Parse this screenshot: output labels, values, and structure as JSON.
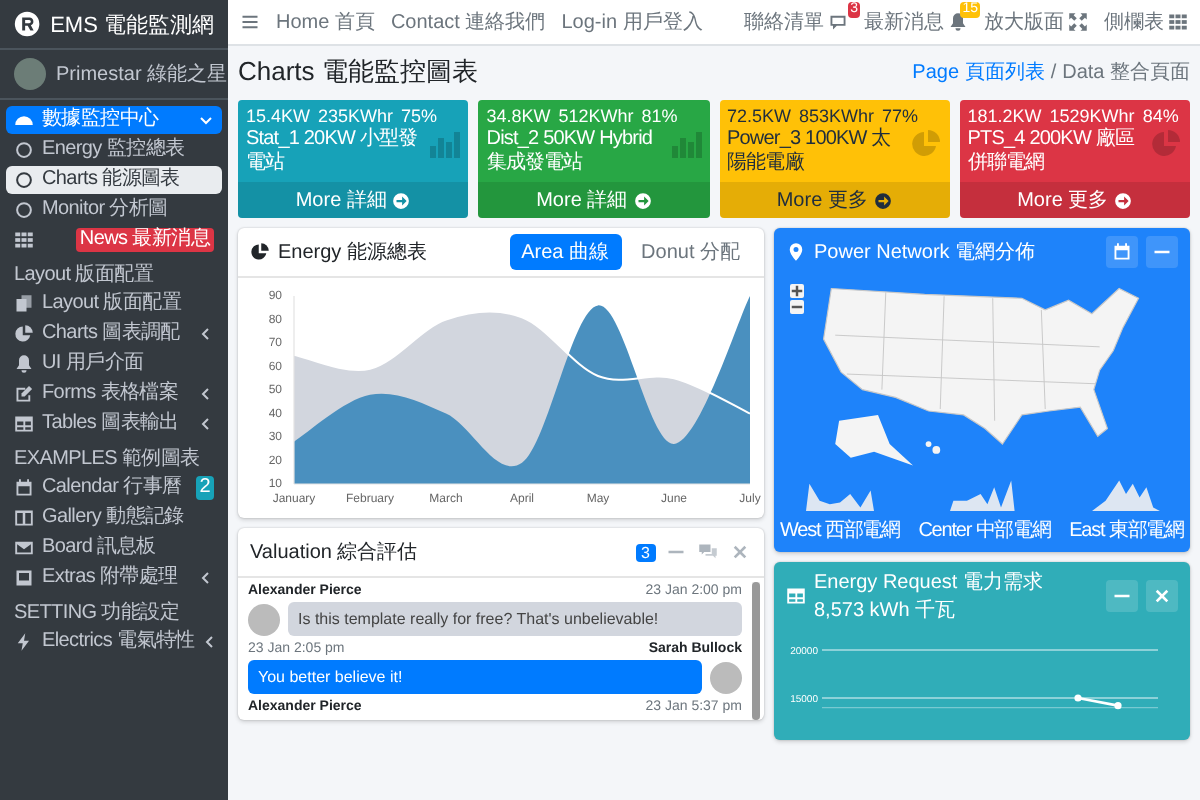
{
  "brand": {
    "title": "EMS 電能監測網"
  },
  "user": {
    "name": "Primestar 綠能之星"
  },
  "sidebar": {
    "items": [
      {
        "kind": "link",
        "label": "數據監控中心",
        "selected": true,
        "expanded": true,
        "children": [
          {
            "label": "Energy 監控總表",
            "selected": false
          },
          {
            "label": "Charts 能源圖表",
            "selected": true
          },
          {
            "label": "Monitor 分析圖",
            "selected": false
          }
        ]
      },
      {
        "kind": "link",
        "selected": false,
        "badge": {
          "text": "News 最新消息",
          "color": "#dc3545"
        }
      },
      {
        "kind": "header",
        "label": "Layout 版面配置"
      },
      {
        "kind": "link",
        "label": "Layout 版面配置",
        "selected": false
      },
      {
        "kind": "link",
        "label": "Charts 圖表調配",
        "selected": false,
        "expanded": false
      },
      {
        "kind": "link",
        "label": "UI 用戶介面",
        "selected": false
      },
      {
        "kind": "link",
        "label": "Forms 表格檔案",
        "selected": false,
        "expanded": false
      },
      {
        "kind": "link",
        "label": "Tables 圖表輸出",
        "selected": false,
        "expanded": false
      },
      {
        "kind": "header",
        "label": "EXAMPLES 範例圖表"
      },
      {
        "kind": "link",
        "label": "Calendar 行事曆",
        "selected": false,
        "badge": {
          "text": "2",
          "color": "#17a2b8"
        }
      },
      {
        "kind": "link",
        "label": "Gallery 動態記錄",
        "selected": false
      },
      {
        "kind": "link",
        "label": "Board 訊息板",
        "selected": false
      },
      {
        "kind": "link",
        "label": "Extras 附帶處理",
        "selected": false,
        "expanded": false
      },
      {
        "kind": "header",
        "label": "SETTING 功能設定"
      },
      {
        "kind": "link",
        "label": "Electrics 電氣特性",
        "selected": false,
        "expanded": false
      }
    ]
  },
  "navbar": {
    "links": [
      "Home 首頁",
      "Contact 連絡我們",
      "Log-in 用戶登入"
    ],
    "actions": [
      {
        "label": "聯絡清單",
        "badge": {
          "text": "3",
          "color": "#dc3545"
        }
      },
      {
        "label": "最新消息",
        "badge": {
          "text": "15",
          "color": "#ffc107"
        }
      },
      {
        "label": "放大版面"
      },
      {
        "label": "側欄表"
      }
    ]
  },
  "page": {
    "title": "Charts 電能監控圖表",
    "breadcrumb": [
      {
        "label": "Page 頁面列表",
        "selected": false
      },
      {
        "label": "Data 整合頁面",
        "selected": true
      }
    ],
    "separator": "/"
  },
  "boxes": [
    {
      "stats": [
        "15.4KW",
        "235KWhr",
        "75%"
      ],
      "subtitle": "Stat_1 20KW 小型發電站",
      "link": "More 詳細",
      "color": "#17a2b8"
    },
    {
      "stats": [
        "34.8KW",
        "512KWhr",
        "81%"
      ],
      "subtitle": "Dist_2 50KW Hybrid 集成發電站",
      "link": "More 詳細",
      "color": "#28a745"
    },
    {
      "stats": [
        "72.5KW",
        "853KWhr",
        "77%"
      ],
      "subtitle": "Power_3 100KW 太陽能電廠",
      "link": "More 更多",
      "color": "#ffc107"
    },
    {
      "stats": [
        "181.2KW",
        "1529KWhr",
        "84%"
      ],
      "subtitle": "PTS_4 200KW 廠區併聯電網",
      "link": "More 更多",
      "color": "#dc3545"
    }
  ],
  "energy": {
    "title": "Energy 能源總表",
    "tabs": [
      {
        "label": "Area 曲線",
        "selected": true
      },
      {
        "label": "Donut 分配",
        "selected": false
      }
    ],
    "chart_data": {
      "type": "area",
      "categories": [
        "January",
        "February",
        "March",
        "April",
        "May",
        "June",
        "July"
      ],
      "ylim": [
        10,
        90
      ],
      "yticks": [
        10,
        20,
        30,
        40,
        50,
        60,
        70,
        80,
        90
      ],
      "series": [
        {
          "color": "#d2d6de",
          "values": [
            65,
            59,
            80,
            81,
            56,
            55,
            40
          ]
        },
        {
          "color": "#4a90bf",
          "values": [
            28,
            48,
            40,
            19,
            86,
            27,
            90
          ]
        }
      ]
    }
  },
  "valuation": {
    "title": "Valuation 綜合評估",
    "badge": "3",
    "messages": [
      {
        "kind": "received",
        "name": "Alexander Pierce",
        "time": "23 Jan 2:00 pm",
        "text": "Is this template really for free? That's unbelievable!"
      },
      {
        "kind": "sent",
        "name": "Sarah Bullock",
        "time": "23 Jan 2:05 pm",
        "text": "You better believe it!"
      },
      {
        "kind": "received",
        "name": "Alexander Pierce",
        "time": "23 Jan 5:37 pm"
      }
    ]
  },
  "network": {
    "title": "Power Network 電網分佈",
    "regions": [
      "West 西部電網",
      "Center 中部電網",
      "East 東部電網"
    ]
  },
  "request": {
    "title": "Energy Request 電力需求",
    "value": "8,573 kWh 千瓦",
    "chart_data": {
      "type": "line",
      "ylim": [
        14000,
        20000
      ],
      "yticks": [
        15000,
        20000
      ],
      "series": [
        {
          "color": "#ffffff",
          "marker": true,
          "values": [
            null,
            null,
            null,
            null,
            null,
            null,
            null,
            15000,
            14200,
            null
          ]
        }
      ]
    }
  }
}
